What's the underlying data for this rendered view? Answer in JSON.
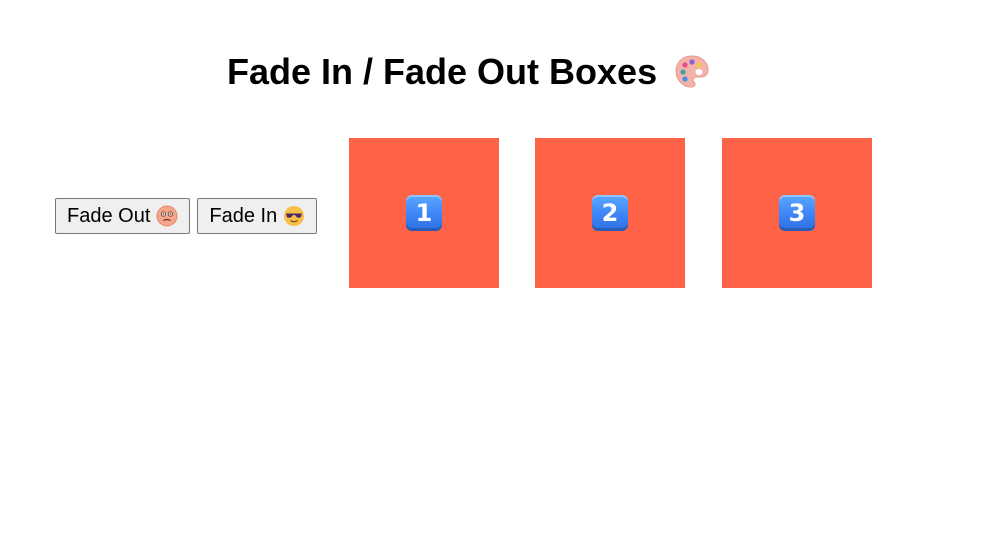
{
  "header": {
    "title": "Fade In / Fade Out Boxes",
    "title_icon": "artist-palette-icon"
  },
  "controls": {
    "fade_out_label": "Fade Out",
    "fade_out_icon": "dizzy-face-icon",
    "fade_in_label": "Fade In",
    "fade_in_icon": "sunglasses-face-icon"
  },
  "boxes": [
    {
      "label": "1",
      "icon": "keycap-1-icon"
    },
    {
      "label": "2",
      "icon": "keycap-2-icon"
    },
    {
      "label": "3",
      "icon": "keycap-3-icon"
    }
  ],
  "colors": {
    "box": "#ff6347",
    "keycap": "#3b82f6",
    "button_bg": "#efefef"
  }
}
